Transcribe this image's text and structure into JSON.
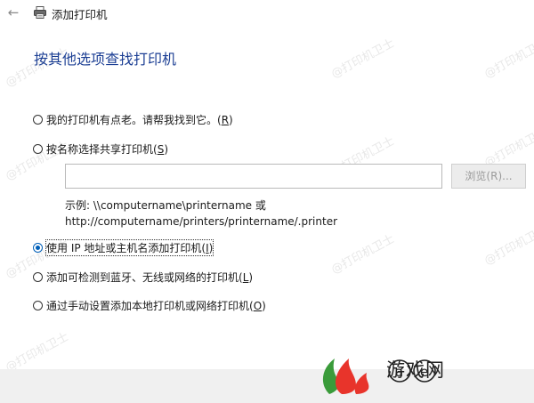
{
  "window": {
    "title": "添加打印机",
    "back_glyph": "←"
  },
  "heading": "按其他选项查找打印机",
  "options": [
    {
      "text": "我的打印机有点老。请帮我找到它。(",
      "key": "R",
      "close": ")",
      "checked": false
    },
    {
      "text": "按名称选择共享打印机(",
      "key": "S",
      "close": ")",
      "checked": false
    },
    {
      "text": "使用 IP 地址或主机名添加打印机(",
      "key": "I",
      "close": ")",
      "checked": true
    },
    {
      "text": "添加可检测到蓝牙、无线或网络的打印机(",
      "key": "L",
      "close": ")",
      "checked": false
    },
    {
      "text": "通过手动设置添加本地打印机或网络打印机(",
      "key": "O",
      "close": ")",
      "checked": false
    }
  ],
  "share_input": {
    "value": ""
  },
  "browse_button": "浏览(R)...",
  "example": {
    "line1": "示例: \\\\computername\\printername 或",
    "line2": "http://computername/printers/printername/.printer"
  },
  "watermark": "@打印机卫士",
  "brand": {
    "text": "游戏网",
    "mark": "@e",
    "accent_red": "#e8342b",
    "accent_green": "#3a9b3a"
  },
  "colors": {
    "heading": "#1c3f94",
    "radio_checked": "#005fb8",
    "footer": "#f0f0f0"
  }
}
